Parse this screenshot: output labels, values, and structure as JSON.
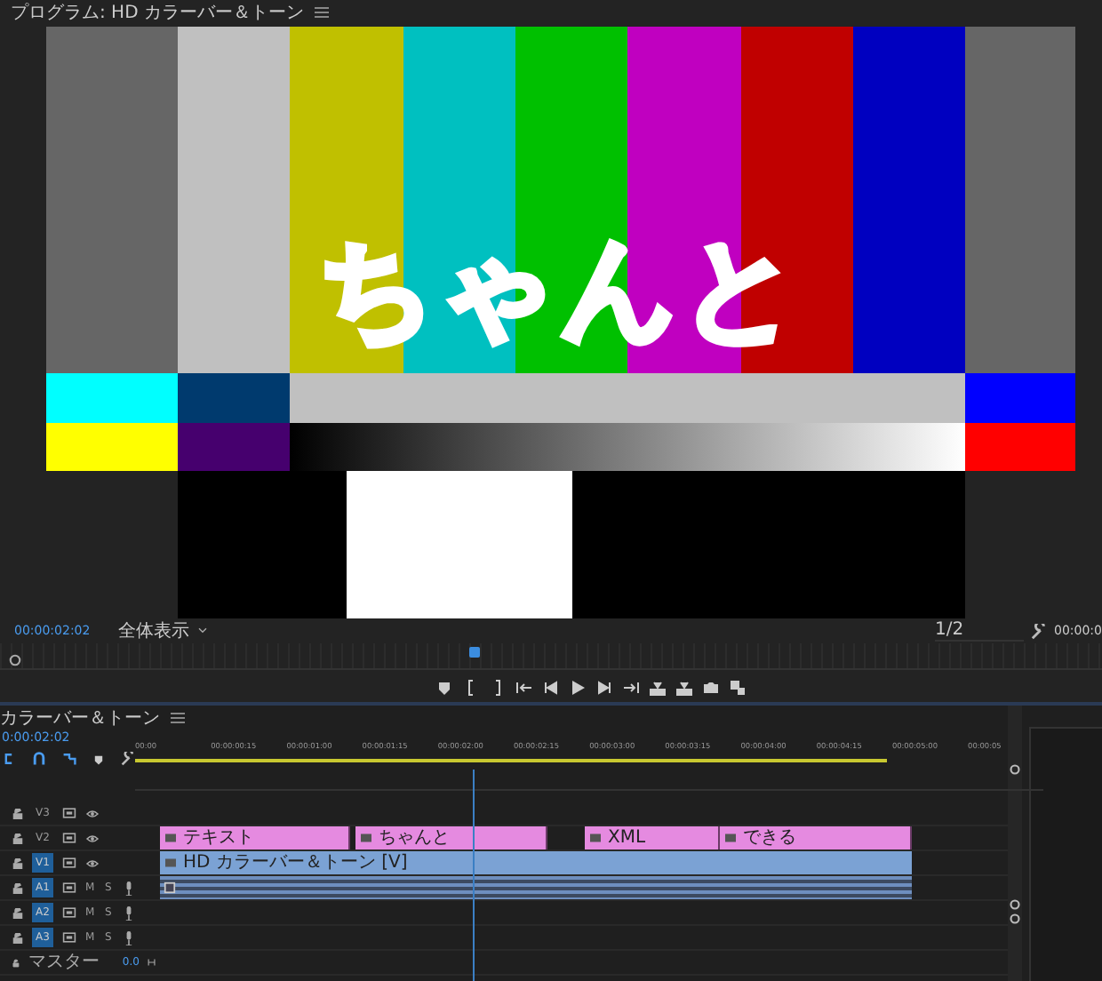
{
  "program_monitor": {
    "title": "プログラム: HD カラーバー＆トーン",
    "overlay_title": "ちゃんと",
    "timecode": "00:00:02:02",
    "zoom_dropdown": "全体表示",
    "resolution_dropdown": "1/2",
    "timecode_right": "00:00:0"
  },
  "timeline": {
    "title": "カラーバー＆トーン",
    "timecode": "0:00:02:02",
    "ruler": [
      "00:00",
      "00:00:00:15",
      "00:00:01:00",
      "00:00:01:15",
      "00:00:02:00",
      "00:00:02:15",
      "00:00:03:00",
      "00:00:03:15",
      "00:00:04:00",
      "00:00:04:15",
      "00:00:05:00",
      "00:00:05"
    ],
    "tracks": [
      {
        "kind": "video",
        "label": "V3",
        "selected": false
      },
      {
        "kind": "video",
        "label": "V2",
        "selected": false,
        "clips": [
          {
            "kind": "graphic",
            "label": "テキスト"
          },
          {
            "kind": "graphic",
            "label": "ちゃんと"
          },
          {
            "kind": "graphic",
            "label": "XML"
          },
          {
            "kind": "graphic",
            "label": "できる"
          }
        ]
      },
      {
        "kind": "video",
        "label": "V1",
        "selected": true,
        "clips": [
          {
            "kind": "video",
            "label": "HD カラーバー＆トーン [V]"
          }
        ]
      },
      {
        "kind": "audio",
        "label": "A1",
        "selected": true,
        "mute": "M",
        "solo": "S",
        "clips": [
          {
            "kind": "audio"
          }
        ]
      },
      {
        "kind": "audio",
        "label": "A2",
        "selected": true,
        "mute": "M",
        "solo": "S"
      },
      {
        "kind": "audio",
        "label": "A3",
        "selected": true,
        "mute": "M",
        "solo": "S"
      },
      {
        "kind": "master",
        "label": "マスター",
        "value": "0.0"
      }
    ]
  }
}
